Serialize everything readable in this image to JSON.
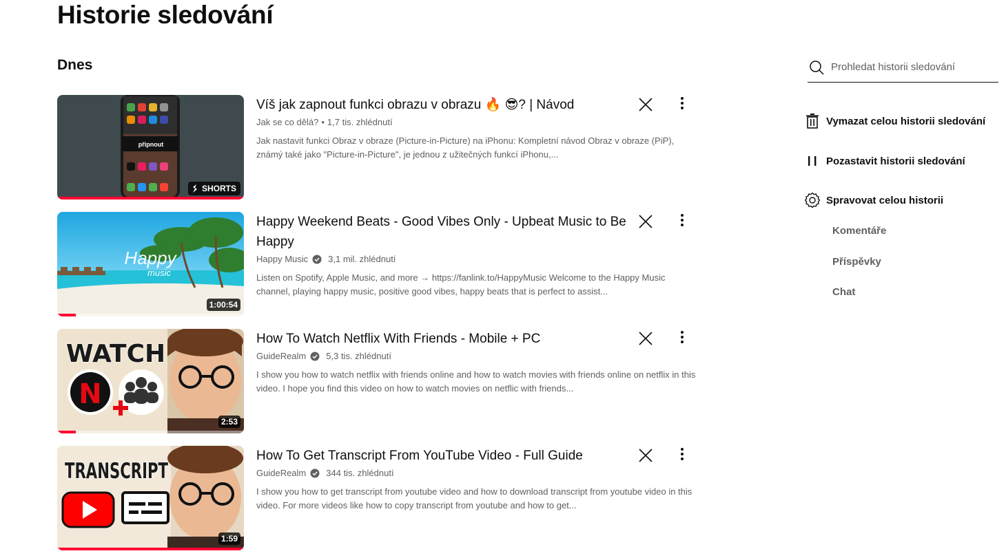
{
  "page": {
    "title": "Historie sledování",
    "section": "Dnes"
  },
  "videos": [
    {
      "title": "Víš jak zapnout funkci obrazu v obrazu 🔥 😎? | Návod",
      "channel": "Jak se co dělá?",
      "verified": false,
      "views": "1,7 tis. zhlédnutí",
      "description": "Jak nastavit funkci Obraz v obraze (Picture-in-Picture) na iPhonu: Kompletní návod Obraz v obraze (PiP), známý také jako \"Picture-in-Picture\", je jednou z užitečných funkcí iPhonu,...",
      "badge": "SHORTS",
      "thumb_text": "připnout",
      "watched_fraction": 1.0
    },
    {
      "title": "Happy Weekend Beats - Good Vibes Only - Upbeat Music to Be Happy",
      "channel": "Happy Music",
      "verified": true,
      "views": "3,1 mil. zhlédnutí",
      "description": "Listen on Spotify, Apple Music, and more → https://fanlink.to/HappyMusic Welcome to the Happy Music channel, playing happy music, positive good vibes, happy beats that is perfect to assist...",
      "duration": "1:00:54",
      "thumb_text": "Happy",
      "thumb_subtext": "music",
      "watched_fraction": 0.1
    },
    {
      "title": "How To Watch Netflix With Friends - Mobile + PC",
      "channel": "GuideRealm",
      "verified": true,
      "views": "5,3 tis. zhlédnutí",
      "description": "I show you how to watch netflix with friends online and how to watch movies with friends online on netflix in this video. I hope you find this video on how to watch movies on netflic with friends...",
      "duration": "2:53",
      "thumb_text": "WATCH",
      "watched_fraction": 0.1
    },
    {
      "title": "How To Get Transcript From YouTube Video - Full Guide",
      "channel": "GuideRealm",
      "verified": true,
      "views": "344 tis. zhlédnutí",
      "description": "I show you how to get transcript from youtube video and how to download transcript from youtube video in this video. For more videos like how to copy transcript from youtube and how to get...",
      "duration": "1:59",
      "thumb_text": "TRANSCRIPT",
      "watched_fraction": 1.0
    }
  ],
  "sidebar": {
    "search_placeholder": "Prohledat historii sledování",
    "clear_all": "Vymazat celou historii sledování",
    "pause": "Pozastavit historii sledování",
    "manage": "Spravovat celou historii",
    "sub_items": [
      "Komentáře",
      "Příspěvky",
      "Chat"
    ]
  },
  "colors": {
    "accent": "#ff0033",
    "text": "#0f0f0f",
    "secondary": "#606060"
  }
}
